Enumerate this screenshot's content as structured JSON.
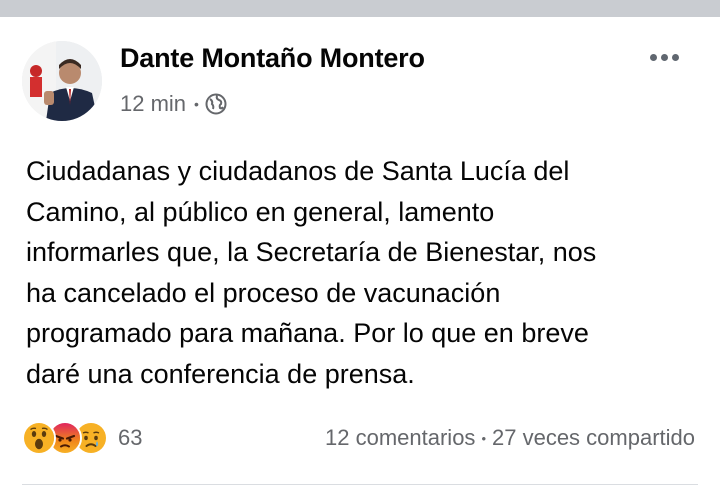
{
  "post": {
    "author": "Dante Montaño Montero",
    "time": "12 min",
    "separator": "•",
    "privacy_icon": "globe-icon",
    "more_icon": "more-options-icon",
    "content_lines": [
      "Ciudadanas y ciudadanos de Santa Lucía del",
      "Camino, al público en general, lamento",
      "informarles que, la Secretaría de Bienestar, nos",
      "ha cancelado el proceso de vacunación",
      "programado para mañana. Por lo que en breve",
      "daré una conferencia de prensa."
    ]
  },
  "footer": {
    "reactions": [
      "wow-reaction-icon",
      "angry-reaction-icon",
      "sad-reaction-icon"
    ],
    "reaction_count": "63",
    "comments": "12 comentarios",
    "separator": "•",
    "shares": "27 veces compartido"
  },
  "colors": {
    "text_primary": "#050505",
    "text_secondary": "#65676b",
    "reaction_yellow": "#f7b125",
    "reaction_angry": "#e9710f",
    "divider": "#dadde1",
    "gap": "#c9ccd1"
  }
}
